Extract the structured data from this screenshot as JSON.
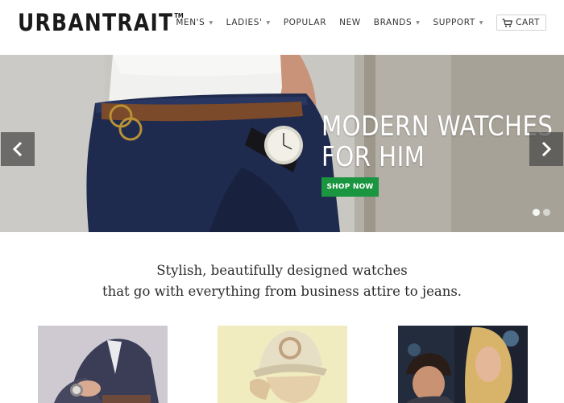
{
  "brand": {
    "name": "URBANTRAIT",
    "trademark": "TM"
  },
  "nav": {
    "items": [
      {
        "label": "MEN'S",
        "has_dropdown": true
      },
      {
        "label": "LADIES'",
        "has_dropdown": true
      },
      {
        "label": "POPULAR",
        "has_dropdown": false
      },
      {
        "label": "NEW",
        "has_dropdown": false
      },
      {
        "label": "BRANDS",
        "has_dropdown": true
      },
      {
        "label": "SUPPORT",
        "has_dropdown": true
      }
    ],
    "cart_label": "CART",
    "cart_icon": "cart-icon"
  },
  "hero": {
    "headline_line1": "MODERN WATCHES",
    "headline_line2": "FOR HIM",
    "cta_label": "SHOP NOW",
    "cta_color": "#1a9540",
    "slide_count": 2,
    "active_slide": 1,
    "prev_icon": "chevron-left-icon",
    "next_icon": "chevron-right-icon"
  },
  "tagline": {
    "line1": "Stylish, beautifully designed watches",
    "line2": "that go with everything from business attire to jeans."
  },
  "tiles": [
    {
      "name": "man-in-blazer-tile"
    },
    {
      "name": "woman-in-cap-tile"
    },
    {
      "name": "couple-tile"
    }
  ],
  "colors": {
    "accent_green": "#1a9540",
    "text_dark": "#222222"
  }
}
